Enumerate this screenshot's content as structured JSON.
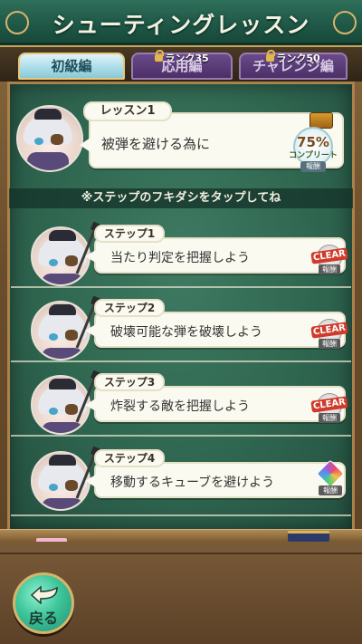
{
  "header": {
    "title": "シューティングレッスン"
  },
  "tabs": [
    {
      "label": "初級編",
      "lock_text": ""
    },
    {
      "label": "応用編",
      "lock_text": "ランク35"
    },
    {
      "label": "チャレンジ編",
      "lock_text": "ランク50"
    }
  ],
  "lesson": {
    "tag": "レッスン1",
    "text": "被弾を避ける為に",
    "progress_percent": "75%",
    "progress_label": "コンプリート",
    "reward_label": "報酬"
  },
  "instruction": "※ステップのフキダシをタップしてね",
  "steps": [
    {
      "tag": "ステップ1",
      "text": "当たり判定を把握しよう",
      "badge": "CLEAR",
      "reward_label": "報酬"
    },
    {
      "tag": "ステップ2",
      "text": "破壊可能な弾を破壊しよう",
      "badge": "CLEAR",
      "reward_label": "報酬"
    },
    {
      "tag": "ステップ3",
      "text": "炸裂する敵を把握しよう",
      "badge": "CLEAR",
      "reward_label": "報酬"
    },
    {
      "tag": "ステップ4",
      "text": "移動するキューブを避けよう",
      "badge": "",
      "reward_label": "報酬"
    }
  ],
  "back_button": {
    "label": "戻る"
  },
  "colors": {
    "board": "#2f6650",
    "accent_gold": "#d7b46c",
    "clear_red": "#d03a2a",
    "back_green": "#3ec59a"
  }
}
